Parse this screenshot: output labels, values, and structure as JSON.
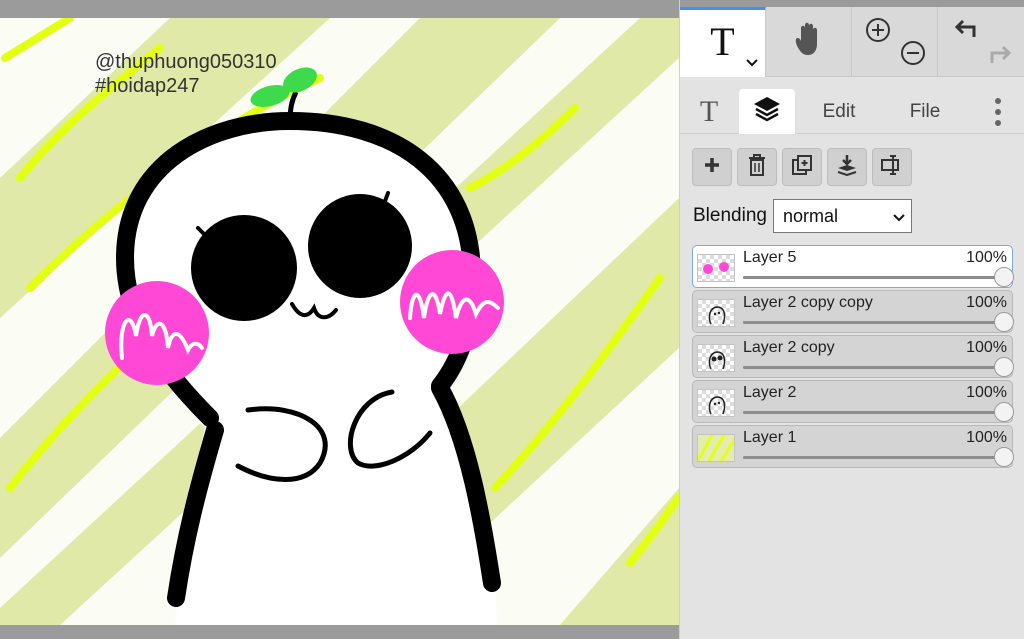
{
  "canvas": {
    "watermark_line1": "@thuphuong050310",
    "watermark_line2": "#hoidap247",
    "colors": {
      "background": "#ffffff",
      "wash": "#dde6a0",
      "highlighter": "#e2ff14",
      "blush": "#ff47d4",
      "sprout": "#39d94a",
      "ink": "#000000"
    }
  },
  "toolbar": {
    "text_tool_icon": "T",
    "text_tool_icon_name": "text-tool-icon",
    "hand_icon_name": "hand-icon",
    "zoom_in_icon_name": "zoom-in-icon",
    "zoom_out_icon_name": "zoom-out-icon",
    "undo_icon_name": "undo-icon",
    "redo_icon_name": "redo-icon"
  },
  "tabs": {
    "text_tab_label": "T",
    "layers_icon_name": "layers-icon",
    "edit_label": "Edit",
    "file_label": "File",
    "more_icon_name": "more-vertical-icon"
  },
  "layer_tools": [
    "add-icon",
    "trash-icon",
    "duplicate-icon",
    "merge-down-icon",
    "resize-icon"
  ],
  "blending": {
    "label": "Blending",
    "value": "normal"
  },
  "layers": [
    {
      "name": "Layer 5",
      "opacity": "100%",
      "opacity_value": 1.0,
      "active": true,
      "thumb": "blush"
    },
    {
      "name": "Layer 2 copy copy",
      "opacity": "100%",
      "opacity_value": 1.0,
      "active": false,
      "thumb": "face"
    },
    {
      "name": "Layer 2 copy",
      "opacity": "100%",
      "opacity_value": 1.0,
      "active": false,
      "thumb": "face-eyes"
    },
    {
      "name": "Layer 2",
      "opacity": "100%",
      "opacity_value": 1.0,
      "active": false,
      "thumb": "face"
    },
    {
      "name": "Layer 1",
      "opacity": "100%",
      "opacity_value": 1.0,
      "active": false,
      "thumb": "stripes"
    }
  ]
}
